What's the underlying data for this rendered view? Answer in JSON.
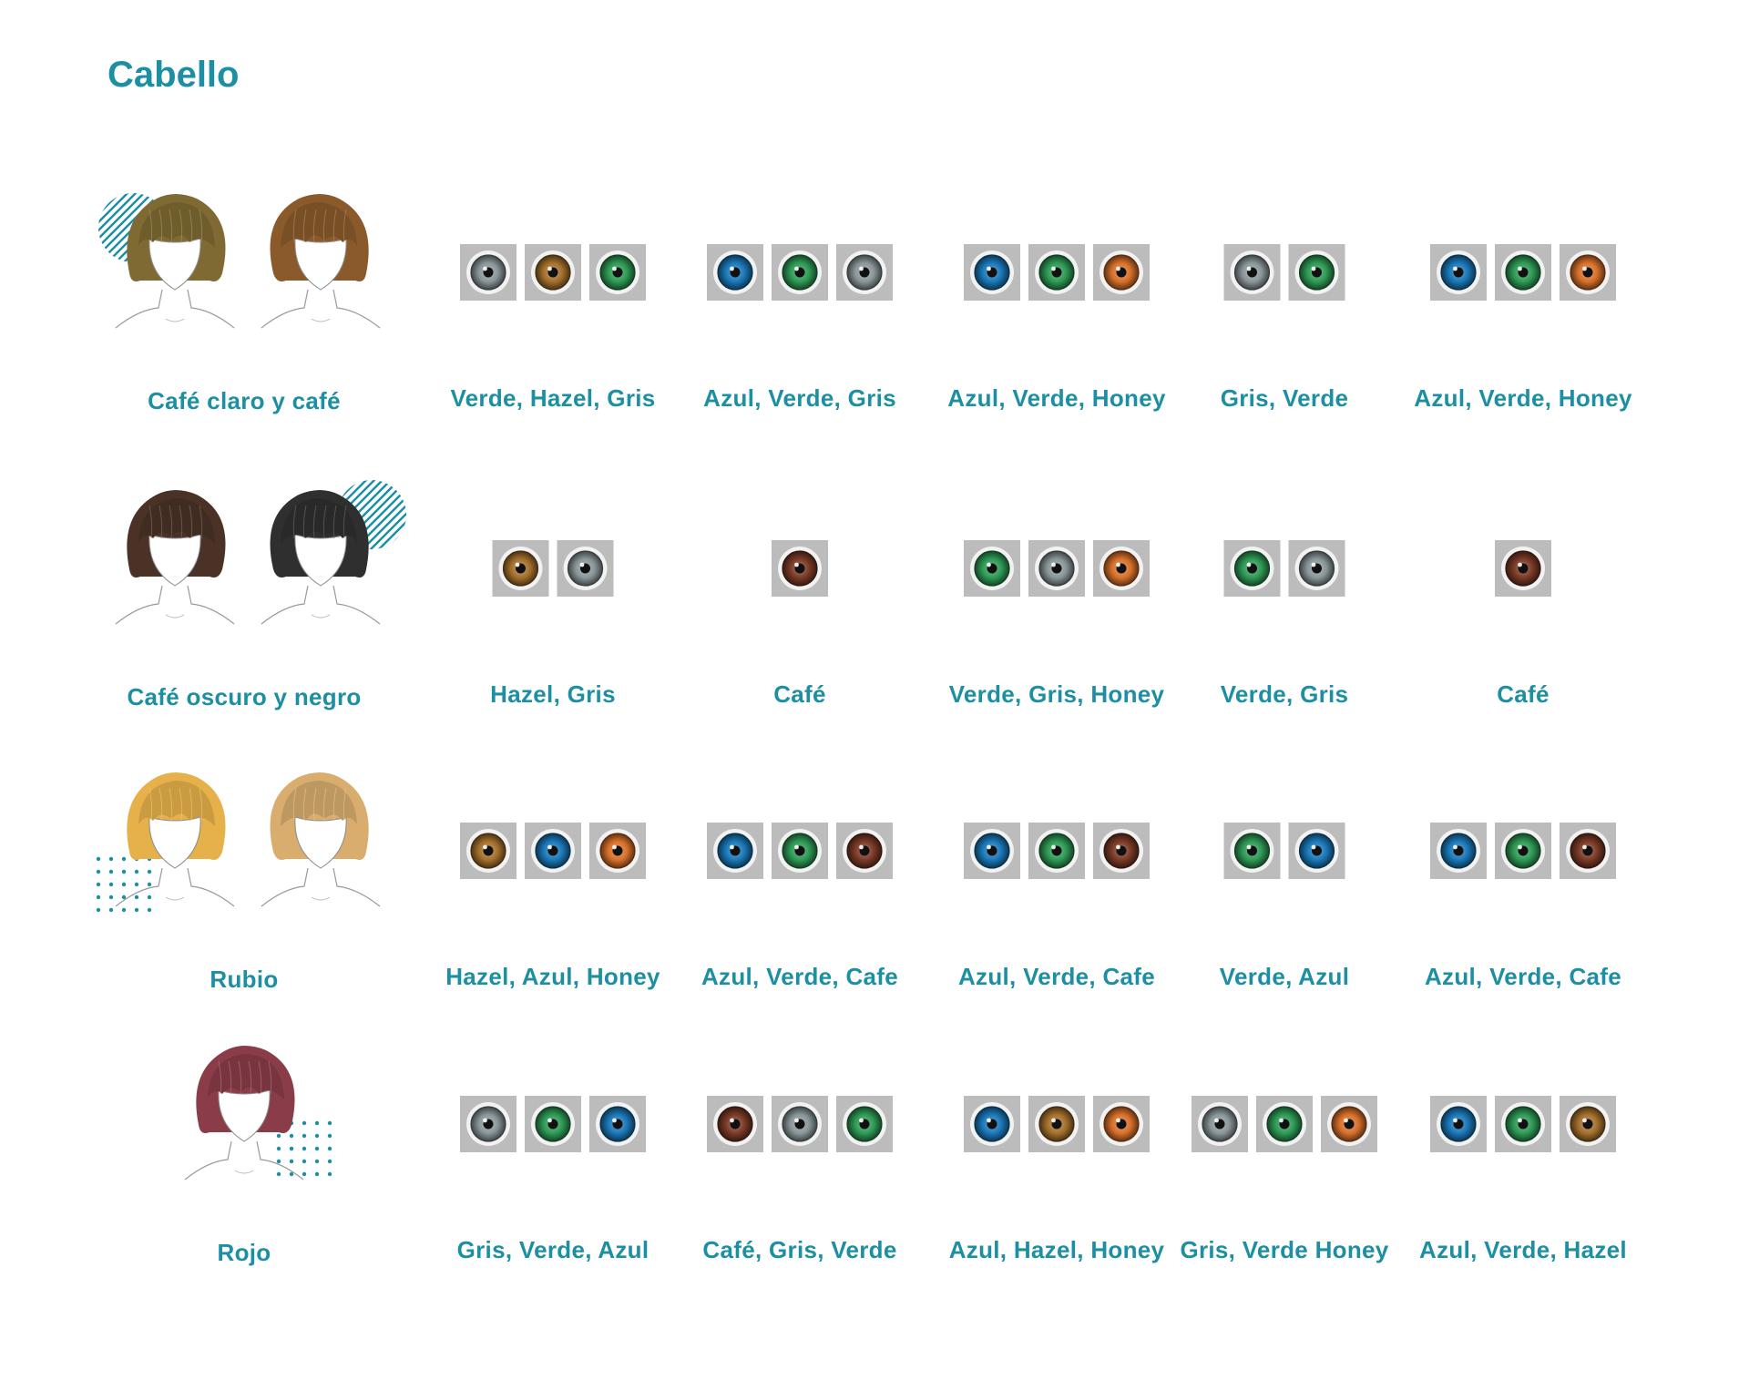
{
  "title": "Cabello",
  "eye_colors": {
    "gris": "#8a969a",
    "hazel": "#a4702c",
    "verde": "#2e9a55",
    "azul": "#1a78b8",
    "honey": "#d8702a",
    "cafe": "#7a3a26"
  },
  "rows": [
    {
      "hair_label": "Café claro y café",
      "figures": [
        {
          "hair": "#7e6a32",
          "pattern": "hatch",
          "pattern_color": "#1d8fa3"
        },
        {
          "hair": "#8a5a2b"
        }
      ],
      "groups": [
        {
          "eyes": [
            "gris",
            "hazel",
            "verde"
          ],
          "label": "Verde, Hazel, Gris"
        },
        {
          "eyes": [
            "azul",
            "verde",
            "gris"
          ],
          "label": "Azul, Verde, Gris"
        },
        {
          "eyes": [
            "azul",
            "verde",
            "honey"
          ],
          "label": "Azul, Verde, Honey"
        },
        {
          "eyes": [
            "gris",
            "verde"
          ],
          "label": "Gris, Verde"
        },
        {
          "eyes": [
            "azul",
            "verde",
            "honey"
          ],
          "label": "Azul, Verde, Honey"
        }
      ]
    },
    {
      "hair_label": "Café oscuro y negro",
      "figures": [
        {
          "hair": "#4a3226"
        },
        {
          "hair": "#2f2f2f",
          "pattern": "hatch",
          "pattern_color": "#1d8fa3"
        }
      ],
      "groups": [
        {
          "eyes": [
            "hazel",
            "gris"
          ],
          "label": "Hazel, Gris"
        },
        {
          "eyes": [
            "cafe"
          ],
          "label": "Café"
        },
        {
          "eyes": [
            "verde",
            "gris",
            "honey"
          ],
          "label": "Verde, Gris, Honey"
        },
        {
          "eyes": [
            "verde",
            "gris"
          ],
          "label": "Verde, Gris"
        },
        {
          "eyes": [
            "cafe"
          ],
          "label": "Café"
        }
      ]
    },
    {
      "hair_label": "Rubio",
      "figures": [
        {
          "hair": "#e6b04a",
          "pattern": "dots",
          "pattern_color": "#1d8fa3"
        },
        {
          "hair": "#d8ad6e"
        }
      ],
      "groups": [
        {
          "eyes": [
            "hazel",
            "azul",
            "honey"
          ],
          "label": "Hazel, Azul, Honey"
        },
        {
          "eyes": [
            "azul",
            "verde",
            "cafe"
          ],
          "label": "Azul, Verde, Cafe"
        },
        {
          "eyes": [
            "azul",
            "verde",
            "cafe"
          ],
          "label": "Azul, Verde, Cafe"
        },
        {
          "eyes": [
            "verde",
            "azul"
          ],
          "label": "Verde, Azul"
        },
        {
          "eyes": [
            "azul",
            "verde",
            "cafe"
          ],
          "label": "Azul, Verde, Cafe"
        }
      ]
    },
    {
      "hair_label": "Rojo",
      "figures": [
        {
          "hair": "#8a3c48",
          "pattern": "dots",
          "pattern_color": "#1d8fa3"
        }
      ],
      "groups": [
        {
          "eyes": [
            "gris",
            "verde",
            "azul"
          ],
          "label": "Gris, Verde, Azul"
        },
        {
          "eyes": [
            "cafe",
            "gris",
            "verde"
          ],
          "label": "Café, Gris, Verde"
        },
        {
          "eyes": [
            "azul",
            "hazel",
            "honey"
          ],
          "label": "Azul, Hazel, Honey"
        },
        {
          "eyes": [
            "gris",
            "verde",
            "honey"
          ],
          "label": "Gris, Verde Honey"
        },
        {
          "eyes": [
            "azul",
            "verde",
            "hazel"
          ],
          "label": "Azul, Verde, Hazel"
        }
      ]
    }
  ]
}
